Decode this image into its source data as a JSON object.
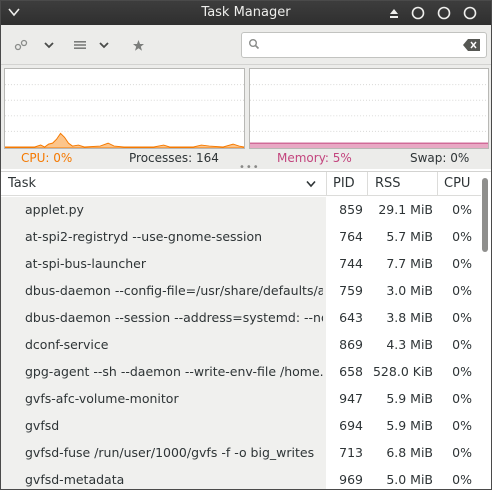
{
  "window": {
    "title": "Task Manager"
  },
  "toolbar": {
    "search_placeholder": ""
  },
  "stats": {
    "cpu_label": "CPU: 0%",
    "processes_label": "Processes: 164",
    "memory_label": "Memory: 5%",
    "swap_label": "Swap: 0%",
    "cpu_color": "#f57900",
    "memory_color": "#c3457e"
  },
  "table": {
    "columns": {
      "task": "Task",
      "pid": "PID",
      "rss": "RSS",
      "cpu": "CPU"
    },
    "rows": [
      {
        "task": "applet.py",
        "pid": "859",
        "rss": "29.1 MiB",
        "cpu": "0%"
      },
      {
        "task": "at-spi2-registryd --use-gnome-session",
        "pid": "764",
        "rss": "5.7 MiB",
        "cpu": "0%"
      },
      {
        "task": "at-spi-bus-launcher",
        "pid": "744",
        "rss": "7.7 MiB",
        "cpu": "0%"
      },
      {
        "task": "dbus-daemon --config-file=/usr/share/defaults/a...",
        "pid": "759",
        "rss": "3.0 MiB",
        "cpu": "0%"
      },
      {
        "task": "dbus-daemon --session --address=systemd: --no...",
        "pid": "643",
        "rss": "3.8 MiB",
        "cpu": "0%"
      },
      {
        "task": "dconf-service",
        "pid": "869",
        "rss": "4.3 MiB",
        "cpu": "0%"
      },
      {
        "task": "gpg-agent --sh --daemon --write-env-file /home...",
        "pid": "658",
        "rss": "528.0 KiB",
        "cpu": "0%"
      },
      {
        "task": "gvfs-afc-volume-monitor",
        "pid": "947",
        "rss": "5.9 MiB",
        "cpu": "0%"
      },
      {
        "task": "gvfsd",
        "pid": "694",
        "rss": "5.9 MiB",
        "cpu": "0%"
      },
      {
        "task": "gvfsd-fuse /run/user/1000/gvfs -f -o big_writes",
        "pid": "713",
        "rss": "6.8 MiB",
        "cpu": "0%"
      },
      {
        "task": "gvfsd-metadata",
        "pid": "969",
        "rss": "5.0 MiB",
        "cpu": "0%"
      }
    ]
  }
}
